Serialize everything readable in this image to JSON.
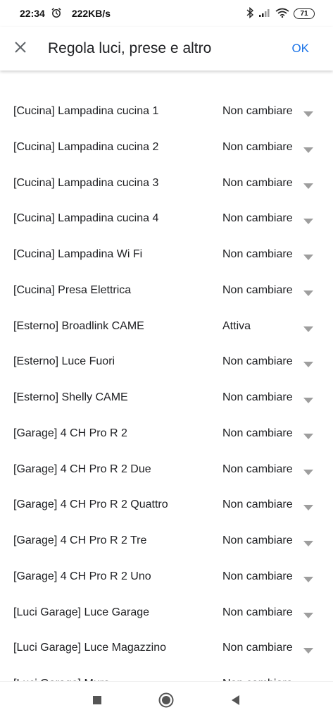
{
  "status_bar": {
    "time": "22:34",
    "speed": "222KB/s",
    "battery": "71",
    "icons": [
      "alarm-icon",
      "bluetooth-icon",
      "signal-icon",
      "wifi-icon",
      "battery-icon"
    ]
  },
  "app_bar": {
    "close_icon": "close-icon",
    "title": "Regola luci, prese e altro",
    "ok_label": "OK",
    "ok_color": "#1a73e8"
  },
  "devices": [
    {
      "name": "[Cucina] Lampadina cucina 1",
      "value": "Non cambiare"
    },
    {
      "name": "[Cucina] Lampadina cucina 2",
      "value": "Non cambiare"
    },
    {
      "name": "[Cucina] Lampadina cucina 3",
      "value": "Non cambiare"
    },
    {
      "name": "[Cucina] Lampadina cucina 4",
      "value": "Non cambiare"
    },
    {
      "name": "[Cucina] Lampadina Wi Fi",
      "value": "Non cambiare"
    },
    {
      "name": "[Cucina] Presa Elettrica",
      "value": "Non cambiare"
    },
    {
      "name": "[Esterno] Broadlink CAME",
      "value": "Attiva"
    },
    {
      "name": "[Esterno] Luce Fuori",
      "value": "Non cambiare"
    },
    {
      "name": "[Esterno] Shelly CAME",
      "value": "Non cambiare"
    },
    {
      "name": "[Garage] 4 CH Pro R 2",
      "value": "Non cambiare"
    },
    {
      "name": "[Garage] 4 CH Pro R 2 Due",
      "value": "Non cambiare"
    },
    {
      "name": "[Garage] 4 CH Pro R 2 Quattro",
      "value": "Non cambiare"
    },
    {
      "name": "[Garage] 4 CH Pro R 2 Tre",
      "value": "Non cambiare"
    },
    {
      "name": "[Garage] 4 CH Pro R 2 Uno",
      "value": "Non cambiare"
    },
    {
      "name": "[Luci Garage] Luce Garage",
      "value": "Non cambiare"
    },
    {
      "name": "[Luci Garage] Luce Magazzino",
      "value": "Non cambiare"
    },
    {
      "name": "[Luci Garage] Muro",
      "value": "Non cambiare"
    }
  ],
  "nav_bar": {
    "icons": [
      "recents-square-icon",
      "home-circle-icon",
      "back-triangle-icon"
    ]
  }
}
